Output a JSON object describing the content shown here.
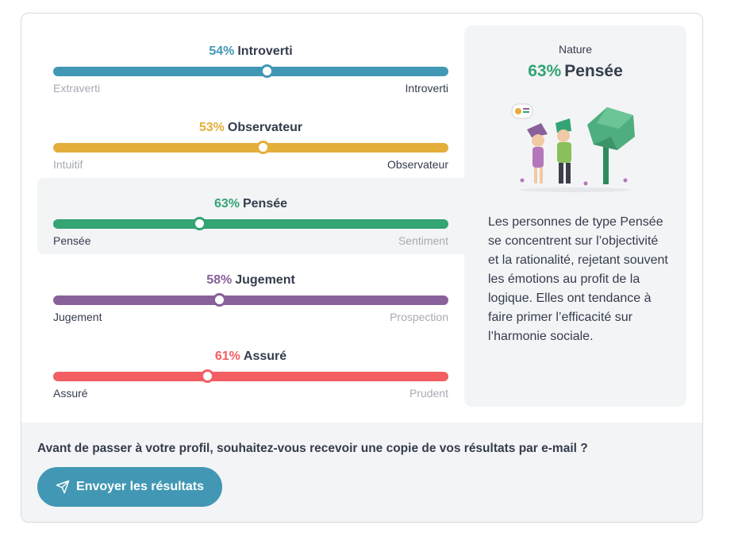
{
  "traits": [
    {
      "pct": "54%",
      "name": "Introverti",
      "left_label": "Extraverti",
      "right_label": "Introverti",
      "position": 0.54,
      "color": "#4298b4",
      "left_muted": true,
      "right_muted": false,
      "active": false
    },
    {
      "pct": "53%",
      "name": "Observateur",
      "left_label": "Intuitif",
      "right_label": "Observateur",
      "position": 0.53,
      "color": "#e4ae3a",
      "left_muted": true,
      "right_muted": false,
      "active": false
    },
    {
      "pct": "63%",
      "name": "Pensée",
      "left_label": "Pensée",
      "right_label": "Sentiment",
      "position": 0.37,
      "color": "#33a474",
      "left_muted": false,
      "right_muted": true,
      "active": true
    },
    {
      "pct": "58%",
      "name": "Jugement",
      "left_label": "Jugement",
      "right_label": "Prospection",
      "position": 0.42,
      "color": "#88619a",
      "left_muted": false,
      "right_muted": true,
      "active": false
    },
    {
      "pct": "61%",
      "name": "Assuré",
      "left_label": "Assuré",
      "right_label": "Prudent",
      "position": 0.39,
      "color": "#f25e62",
      "left_muted": false,
      "right_muted": true,
      "active": false
    }
  ],
  "side": {
    "category": "Nature",
    "pct": "63%",
    "title": "Pensée",
    "description": "Les personnes de type Pensée se concentrent sur l’objectivité et la rationalité, rejetant souvent les émotions au profit de la logique. Elles ont tendance à faire primer l’efficacité sur l’harmonie sociale.",
    "illustration": "thinking-characters-illustration"
  },
  "footer": {
    "question": "Avant de passer à votre profil, souhaitez-vous recevoir une copie de vos résultats par e-mail ?",
    "button_label": "Envoyer les résultats",
    "button_icon": "send-icon"
  }
}
